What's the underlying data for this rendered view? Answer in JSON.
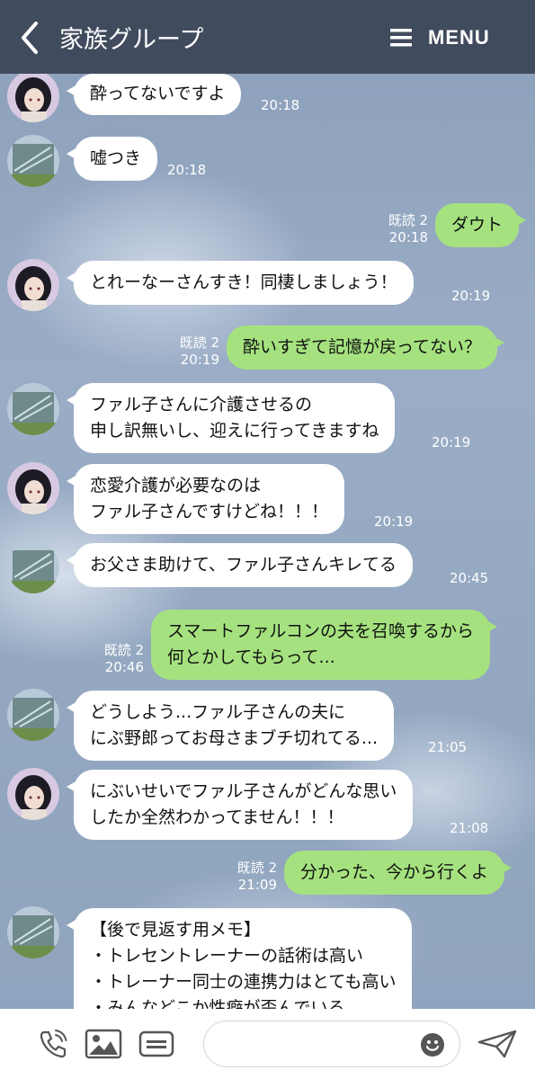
{
  "header": {
    "title": "家族グループ",
    "menu_label": "MENU",
    "background": "#414b5e"
  },
  "colors": {
    "incoming_bubble": "#ffffff",
    "outgoing_bubble": "#a5e27f",
    "meta_text": "#ffffff"
  },
  "messages": [
    {
      "dir": "in",
      "avatar": "girl",
      "lines": [
        "酔ってないですよ"
      ],
      "time": "20:18"
    },
    {
      "dir": "in",
      "avatar": "building",
      "lines": [
        "嘘つき"
      ],
      "time": "20:18"
    },
    {
      "dir": "out",
      "read": "既読 2",
      "lines": [
        "ダウト"
      ],
      "time": "20:18"
    },
    {
      "dir": "in",
      "avatar": "girl",
      "lines": [
        "とれーなーさんすき！同棲しましょう！"
      ],
      "time": "20:19"
    },
    {
      "dir": "out",
      "read": "既読 2",
      "lines": [
        "酔いすぎて記憶が戻ってない？"
      ],
      "time": "20:19"
    },
    {
      "dir": "in",
      "avatar": "building",
      "lines": [
        "ファル子さんに介護させるの",
        "申し訳無いし、迎えに行ってきますね"
      ],
      "time": "20:19"
    },
    {
      "dir": "in",
      "avatar": "girl",
      "lines": [
        "恋愛介護が必要なのは",
        "ファル子さんですけどね！！！"
      ],
      "time": "20:19"
    },
    {
      "dir": "in",
      "avatar": "building",
      "lines": [
        "お父さま助けて、ファル子さんキレてる"
      ],
      "time": "20:45"
    },
    {
      "dir": "out",
      "read": "既読 2",
      "lines": [
        "スマートファルコンの夫を召喚するから",
        "何とかしてもらって..."
      ],
      "time": "20:46"
    },
    {
      "dir": "in",
      "avatar": "building",
      "lines": [
        "どうしよう...ファル子さんの夫に",
        "にぶ野郎ってお母さまブチ切れてる..."
      ],
      "time": "21:05"
    },
    {
      "dir": "in",
      "avatar": "girl",
      "lines": [
        "にぶいせいでファル子さんがどんな思い",
        "したか全然わかってません！！！"
      ],
      "time": "21:08"
    },
    {
      "dir": "out",
      "read": "既読 2",
      "lines": [
        "分かった、今から行くよ"
      ],
      "time": "21:09"
    },
    {
      "dir": "in",
      "avatar": "building",
      "lines": [
        "【後で見返す用メモ】",
        "・トレセントレーナーの話術は高い",
        "・トレーナー同士の連携力はとても高い",
        "・みんなどこか性癖が歪んでいる"
      ],
      "time": ""
    }
  ],
  "footer": {
    "icons": [
      "phone-icon",
      "image-icon",
      "stamp-list-icon",
      "emoji-icon",
      "send-icon"
    ],
    "input_placeholder": ""
  }
}
